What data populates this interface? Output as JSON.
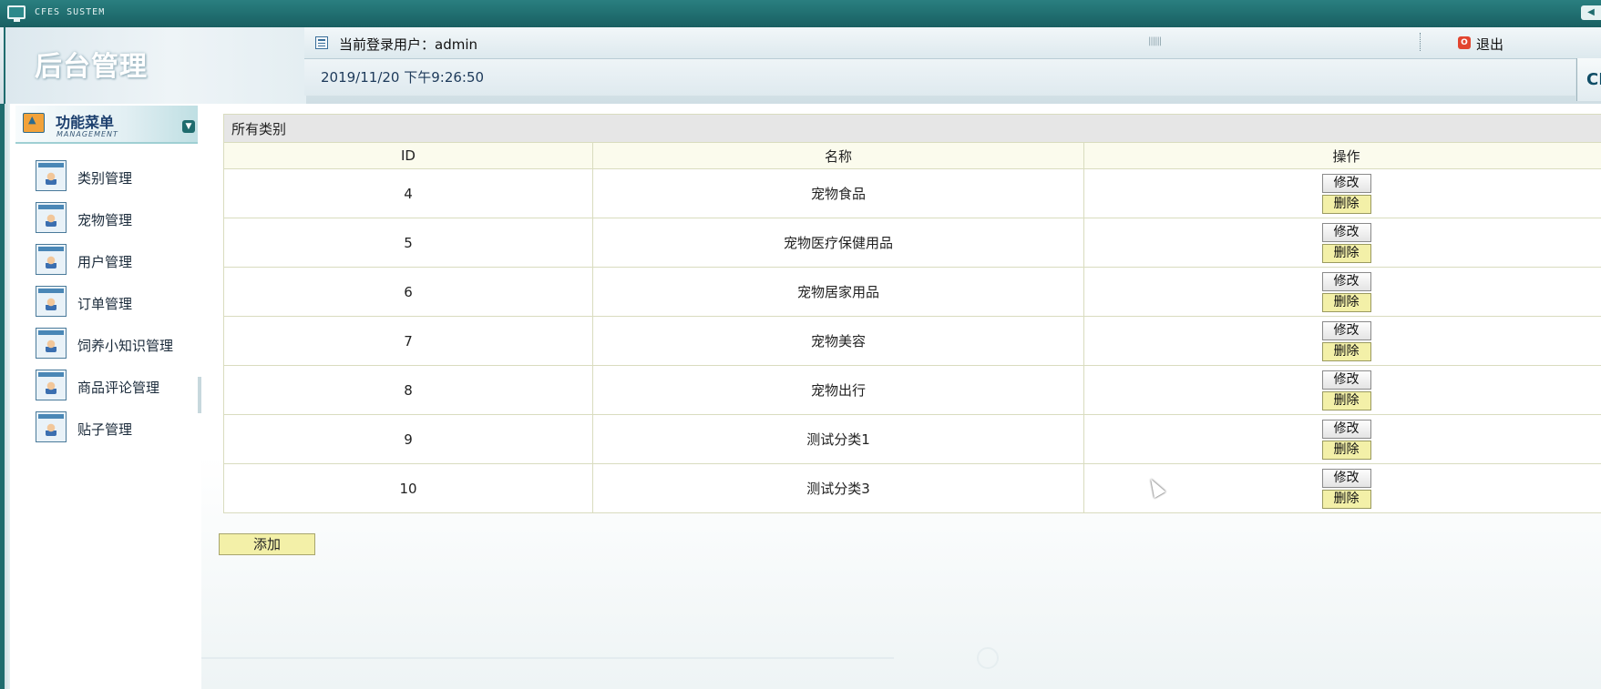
{
  "window": {
    "system_title": "CFES SUSTEM"
  },
  "header": {
    "brand": "后台管理",
    "current_user": "当前登录用户：admin",
    "datetime": "2019/11/20 下午9:26:50",
    "logout": "退出",
    "right_fragment": "CI"
  },
  "sidebar": {
    "title": "功能菜单",
    "subtitle": "MANAGEMENT",
    "items": [
      {
        "label": "类别管理"
      },
      {
        "label": "宠物管理"
      },
      {
        "label": "用户管理"
      },
      {
        "label": "订单管理"
      },
      {
        "label": "饲养小知识管理"
      },
      {
        "label": "商品评论管理"
      },
      {
        "label": "贴子管理"
      }
    ]
  },
  "table": {
    "caption": "所有类别",
    "columns": [
      "ID",
      "名称",
      "操作"
    ],
    "rows": [
      {
        "id": "4",
        "name": "宠物食品"
      },
      {
        "id": "5",
        "name": "宠物医疗保健用品"
      },
      {
        "id": "6",
        "name": "宠物居家用品"
      },
      {
        "id": "7",
        "name": "宠物美容"
      },
      {
        "id": "8",
        "name": "宠物出行"
      },
      {
        "id": "9",
        "name": "测试分类1"
      },
      {
        "id": "10",
        "name": "测试分类3"
      }
    ],
    "edit_label": "修改",
    "delete_label": "删除"
  },
  "actions": {
    "add_label": "添加"
  },
  "colors": {
    "frame": "#1f6c6e",
    "delete_button": "#f3f0a8",
    "caption_bg": "#e6e6e6"
  }
}
